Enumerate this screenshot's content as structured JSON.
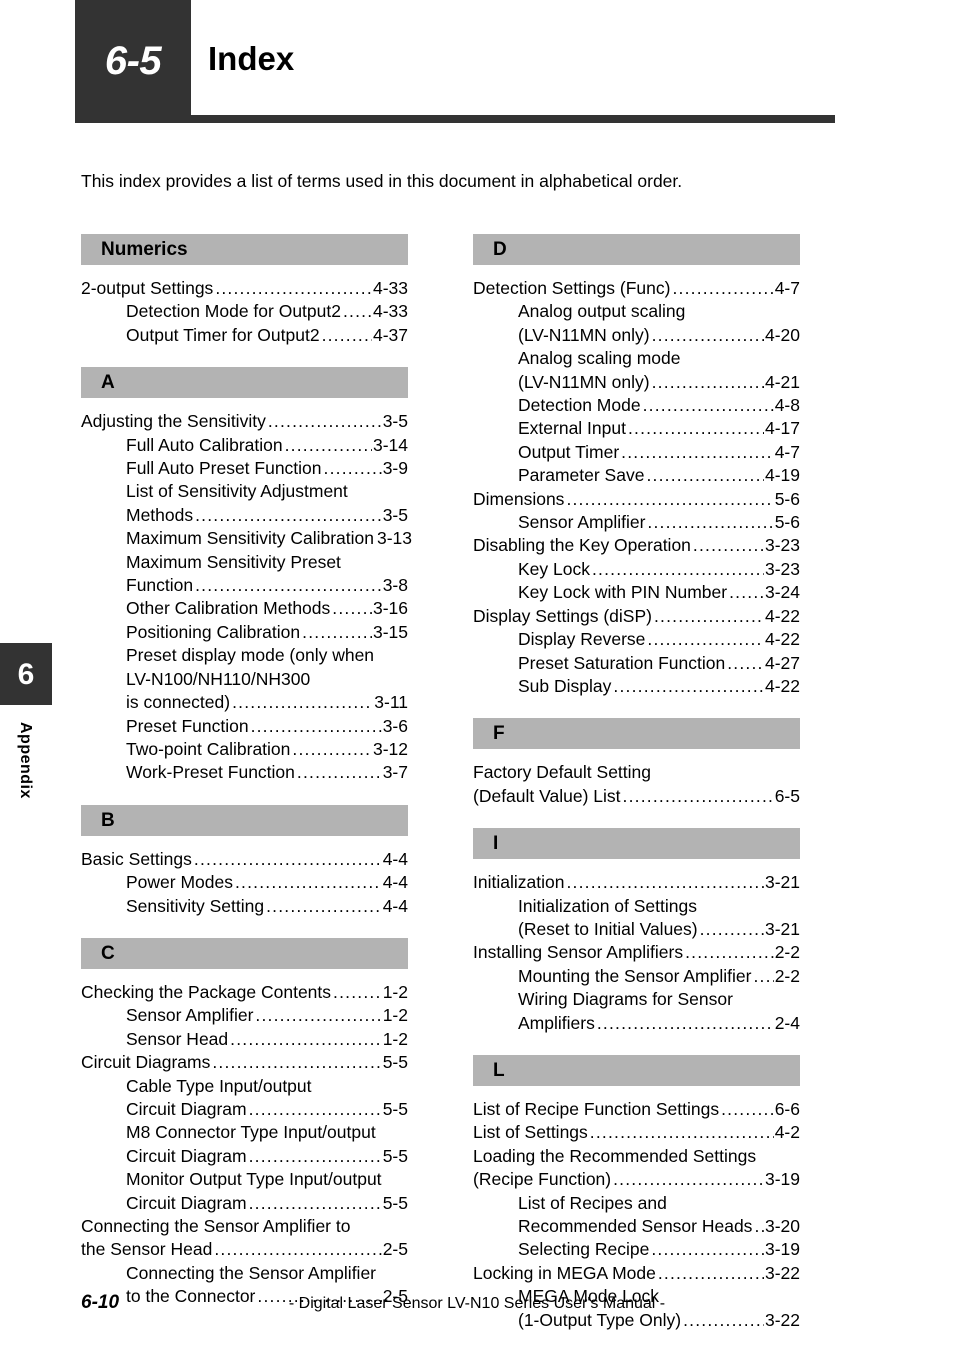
{
  "header": {
    "chapter_number": "6-5",
    "title": "Index"
  },
  "intro": {
    "text": "This index provides a list of terms used in this document in alphabetical order."
  },
  "side_tab": {
    "chapter_number": "6",
    "section_label": "Appendix"
  },
  "footer": {
    "page_number": "6-10",
    "manual_title": "- Digital Laser Sensor LV-N10 Series User's Manual -"
  },
  "colors": {
    "header_dark": "#333333",
    "letter_bar_gray": "#b3b3b3",
    "text": "#000000",
    "page_background": "#ffffff"
  },
  "left_column": [
    {
      "letter": "Numerics",
      "entries": [
        {
          "label": "2-output Settings",
          "page": "4-33",
          "level": 0,
          "leader": true
        },
        {
          "label": "Detection Mode for Output2",
          "page": "4-33",
          "level": 1,
          "leader": true
        },
        {
          "label": "Output Timer for Output2",
          "page": "4-37",
          "level": 1,
          "leader": true
        }
      ]
    },
    {
      "letter": "A",
      "entries": [
        {
          "label": "Adjusting the Sensitivity",
          "page": "3-5",
          "level": 0,
          "leader": true
        },
        {
          "label": "Full Auto Calibration",
          "page": "3-14",
          "level": 1,
          "leader": true
        },
        {
          "label": "Full Auto Preset Function",
          "page": "3-9",
          "level": 1,
          "leader": true
        },
        {
          "label": "List of Sensitivity Adjustment",
          "page": "",
          "level": 1,
          "leader": false
        },
        {
          "label": "Methods",
          "page": "3-5",
          "level": 1,
          "leader": true
        },
        {
          "label": "Maximum Sensitivity Calibration",
          "page": "3-13",
          "level": 1,
          "leader": false,
          "tight": true
        },
        {
          "label": "Maximum Sensitivity Preset",
          "page": "",
          "level": 1,
          "leader": false
        },
        {
          "label": "Function",
          "page": "3-8",
          "level": 1,
          "leader": true
        },
        {
          "label": "Other Calibration Methods",
          "page": "3-16",
          "level": 1,
          "leader": true
        },
        {
          "label": "Positioning Calibration",
          "page": "3-15",
          "level": 1,
          "leader": true
        },
        {
          "label": "Preset display mode (only when",
          "page": "",
          "level": 1,
          "leader": false
        },
        {
          "label": "LV-N100/NH110/NH300",
          "page": "",
          "level": 1,
          "leader": false
        },
        {
          "label": "is connected)",
          "page": "3-11",
          "level": 1,
          "leader": true
        },
        {
          "label": "Preset Function",
          "page": "3-6",
          "level": 1,
          "leader": true
        },
        {
          "label": "Two-point Calibration",
          "page": "3-12",
          "level": 1,
          "leader": true
        },
        {
          "label": "Work-Preset Function",
          "page": "3-7",
          "level": 1,
          "leader": true
        }
      ]
    },
    {
      "letter": "B",
      "entries": [
        {
          "label": "Basic Settings",
          "page": "4-4",
          "level": 0,
          "leader": true
        },
        {
          "label": "Power Modes",
          "page": "4-4",
          "level": 1,
          "leader": true
        },
        {
          "label": "Sensitivity Setting",
          "page": "4-4",
          "level": 1,
          "leader": true
        }
      ]
    },
    {
      "letter": "C",
      "entries": [
        {
          "label": "Checking the Package Contents",
          "page": "1-2",
          "level": 0,
          "leader": true
        },
        {
          "label": "Sensor Amplifier",
          "page": "1-2",
          "level": 1,
          "leader": true
        },
        {
          "label": "Sensor Head",
          "page": "1-2",
          "level": 1,
          "leader": true
        },
        {
          "label": "Circuit Diagrams",
          "page": "5-5",
          "level": 0,
          "leader": true
        },
        {
          "label": "Cable Type Input/output",
          "page": "",
          "level": 1,
          "leader": false
        },
        {
          "label": "Circuit Diagram",
          "page": "5-5",
          "level": 1,
          "leader": true
        },
        {
          "label": "M8 Connector Type Input/output",
          "page": "",
          "level": 1,
          "leader": false
        },
        {
          "label": "Circuit Diagram",
          "page": "5-5",
          "level": 1,
          "leader": true
        },
        {
          "label": "Monitor Output Type Input/output",
          "page": "",
          "level": 1,
          "leader": false
        },
        {
          "label": "Circuit Diagram",
          "page": "5-5",
          "level": 1,
          "leader": true
        },
        {
          "label": "Connecting the Sensor Amplifier to",
          "page": "",
          "level": 0,
          "leader": false
        },
        {
          "label": "the Sensor Head",
          "page": "2-5",
          "level": 0,
          "leader": true
        },
        {
          "label": "Connecting the Sensor Amplifier",
          "page": "",
          "level": 1,
          "leader": false
        },
        {
          "label": "to the Connector",
          "page": "2-5",
          "level": 1,
          "leader": true
        }
      ]
    }
  ],
  "right_column": [
    {
      "letter": "D",
      "entries": [
        {
          "label": "Detection Settings (Func)",
          "page": "4-7",
          "level": 0,
          "leader": true
        },
        {
          "label": "Analog output scaling",
          "page": "",
          "level": 1,
          "leader": false
        },
        {
          "label": "(LV-N11MN only)",
          "page": "4-20",
          "level": 1,
          "leader": true
        },
        {
          "label": "Analog scaling mode",
          "page": "",
          "level": 1,
          "leader": false
        },
        {
          "label": "(LV-N11MN only)",
          "page": "4-21",
          "level": 1,
          "leader": true
        },
        {
          "label": "Detection Mode",
          "page": "4-8",
          "level": 1,
          "leader": true
        },
        {
          "label": "External Input",
          "page": "4-17",
          "level": 1,
          "leader": true
        },
        {
          "label": "Output Timer",
          "page": "4-7",
          "level": 1,
          "leader": true
        },
        {
          "label": "Parameter Save",
          "page": "4-19",
          "level": 1,
          "leader": true
        },
        {
          "label": "Dimensions",
          "page": "5-6",
          "level": 0,
          "leader": true
        },
        {
          "label": "Sensor Amplifier",
          "page": "5-6",
          "level": 1,
          "leader": true
        },
        {
          "label": "Disabling the Key Operation",
          "page": "3-23",
          "level": 0,
          "leader": true
        },
        {
          "label": "Key Lock",
          "page": "3-23",
          "level": 1,
          "leader": true
        },
        {
          "label": "Key Lock with PIN Number",
          "page": "3-24",
          "level": 1,
          "leader": true
        },
        {
          "label": "Display Settings (diSP)",
          "page": "4-22",
          "level": 0,
          "leader": true
        },
        {
          "label": "Display Reverse",
          "page": "4-22",
          "level": 1,
          "leader": true
        },
        {
          "label": "Preset Saturation Function",
          "page": "4-27",
          "level": 1,
          "leader": true
        },
        {
          "label": "Sub Display",
          "page": "4-22",
          "level": 1,
          "leader": true
        }
      ]
    },
    {
      "letter": "F",
      "entries": [
        {
          "label": "Factory Default Setting",
          "page": "",
          "level": 0,
          "leader": false
        },
        {
          "label": "(Default Value) List",
          "page": "6-5",
          "level": 0,
          "leader": true
        }
      ]
    },
    {
      "letter": "I",
      "entries": [
        {
          "label": "Initialization",
          "page": "3-21",
          "level": 0,
          "leader": true
        },
        {
          "label": "Initialization of Settings",
          "page": "",
          "level": 1,
          "leader": false
        },
        {
          "label": "(Reset to Initial Values)",
          "page": "3-21",
          "level": 1,
          "leader": true
        },
        {
          "label": "Installing Sensor Amplifiers",
          "page": "2-2",
          "level": 0,
          "leader": true
        },
        {
          "label": "Mounting the Sensor Amplifier",
          "page": "2-2",
          "level": 1,
          "leader": true
        },
        {
          "label": "Wiring Diagrams for Sensor",
          "page": "",
          "level": 1,
          "leader": false
        },
        {
          "label": "Amplifiers",
          "page": "2-4",
          "level": 1,
          "leader": true
        }
      ]
    },
    {
      "letter": "L",
      "entries": [
        {
          "label": "List of Recipe Function Settings",
          "page": "6-6",
          "level": 0,
          "leader": true
        },
        {
          "label": "List of Settings",
          "page": "4-2",
          "level": 0,
          "leader": true
        },
        {
          "label": "Loading the Recommended Settings",
          "page": "",
          "level": 0,
          "leader": false
        },
        {
          "label": "(Recipe Function)",
          "page": "3-19",
          "level": 0,
          "leader": true
        },
        {
          "label": "List of Recipes and",
          "page": "",
          "level": 1,
          "leader": false
        },
        {
          "label": "Recommended Sensor Heads",
          "page": "3-20",
          "level": 1,
          "leader": true
        },
        {
          "label": "Selecting Recipe",
          "page": "3-19",
          "level": 1,
          "leader": true
        },
        {
          "label": "Locking in MEGA Mode",
          "page": "3-22",
          "level": 0,
          "leader": true
        },
        {
          "label": "MEGA Mode Lock",
          "page": "",
          "level": 1,
          "leader": false
        },
        {
          "label": "(1-Output Type Only)",
          "page": "3-22",
          "level": 1,
          "leader": true
        }
      ]
    }
  ]
}
